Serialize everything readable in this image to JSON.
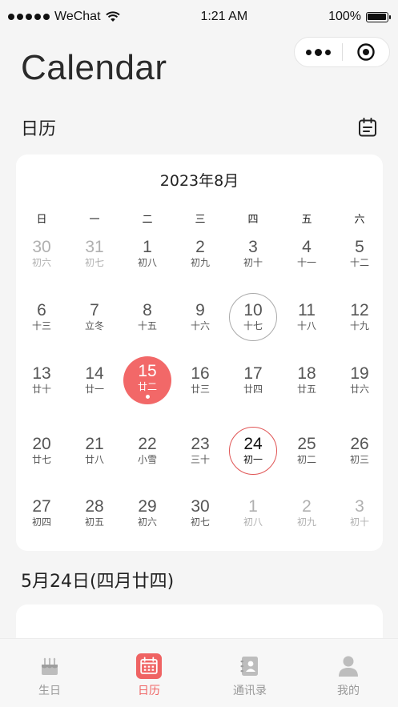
{
  "status_bar": {
    "carrier": "WeChat",
    "time": "1:21 AM",
    "battery": "100%"
  },
  "header": {
    "title": "Calendar"
  },
  "section": {
    "title": "日历"
  },
  "calendar": {
    "month_title": "2023年8月",
    "weekdays": [
      "日",
      "一",
      "二",
      "三",
      "四",
      "五",
      "六"
    ],
    "weeks": [
      [
        {
          "num": "30",
          "lunar": "初六",
          "other": true
        },
        {
          "num": "31",
          "lunar": "初七",
          "other": true
        },
        {
          "num": "1",
          "lunar": "初八"
        },
        {
          "num": "2",
          "lunar": "初九"
        },
        {
          "num": "3",
          "lunar": "初十"
        },
        {
          "num": "4",
          "lunar": "十一"
        },
        {
          "num": "5",
          "lunar": "十二"
        }
      ],
      [
        {
          "num": "6",
          "lunar": "十三"
        },
        {
          "num": "7",
          "lunar": "立冬"
        },
        {
          "num": "8",
          "lunar": "十五"
        },
        {
          "num": "9",
          "lunar": "十六"
        },
        {
          "num": "10",
          "lunar": "十七",
          "state": "grey-ring"
        },
        {
          "num": "11",
          "lunar": "十八"
        },
        {
          "num": "12",
          "lunar": "十九"
        }
      ],
      [
        {
          "num": "13",
          "lunar": "廿十"
        },
        {
          "num": "14",
          "lunar": "廿一"
        },
        {
          "num": "15",
          "lunar": "廿二",
          "state": "selected"
        },
        {
          "num": "16",
          "lunar": "廿三"
        },
        {
          "num": "17",
          "lunar": "廿四"
        },
        {
          "num": "18",
          "lunar": "廿五"
        },
        {
          "num": "19",
          "lunar": "廿六"
        }
      ],
      [
        {
          "num": "20",
          "lunar": "廿七"
        },
        {
          "num": "21",
          "lunar": "廿八"
        },
        {
          "num": "22",
          "lunar": "小雪"
        },
        {
          "num": "23",
          "lunar": "三十"
        },
        {
          "num": "24",
          "lunar": "初一",
          "state": "red-ring"
        },
        {
          "num": "25",
          "lunar": "初二"
        },
        {
          "num": "26",
          "lunar": "初三"
        }
      ],
      [
        {
          "num": "27",
          "lunar": "初四"
        },
        {
          "num": "28",
          "lunar": "初五"
        },
        {
          "num": "29",
          "lunar": "初六"
        },
        {
          "num": "30",
          "lunar": "初七"
        },
        {
          "num": "1",
          "lunar": "初八",
          "other": true
        },
        {
          "num": "2",
          "lunar": "初九",
          "other": true
        },
        {
          "num": "3",
          "lunar": "初十",
          "other": true
        }
      ]
    ]
  },
  "selected_date_heading": "5月24日(四月廿四)",
  "tabbar": {
    "tabs": [
      {
        "label": "生日",
        "icon": "cake-icon",
        "active": false
      },
      {
        "label": "日历",
        "icon": "calendar-icon",
        "active": true
      },
      {
        "label": "通讯录",
        "icon": "contacts-icon",
        "active": false
      },
      {
        "label": "我的",
        "icon": "person-icon",
        "active": false
      }
    ]
  },
  "colors": {
    "accent": "#f26868",
    "inactive": "#999999",
    "background": "#f5f5f5"
  }
}
